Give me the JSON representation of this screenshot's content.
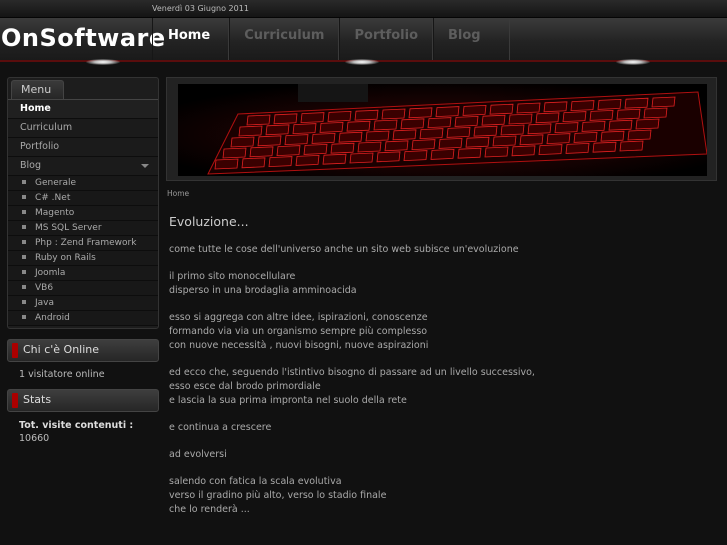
{
  "topbar": {
    "date": "Venerdì 03 Giugno 2011"
  },
  "header": {
    "logo": "OnSoftware",
    "nav": [
      {
        "label": "Home",
        "active": true
      },
      {
        "label": "Curriculum",
        "active": false
      },
      {
        "label": "Portfolio",
        "active": false
      },
      {
        "label": "Blog",
        "active": false
      }
    ]
  },
  "sidebar": {
    "menu_title": "Menu",
    "items": [
      {
        "label": "Home"
      },
      {
        "label": "Curriculum"
      },
      {
        "label": "Portfolio"
      },
      {
        "label": "Blog"
      }
    ],
    "blog_subitems": [
      "Generale",
      "C# .Net",
      "Magento",
      "MS SQL Server",
      "Php : Zend Framework",
      "Ruby on Rails",
      "Joomla",
      "VB6",
      "Java",
      "Android"
    ],
    "online": {
      "title": "Chi c'è Online",
      "text": "1 visitatore online"
    },
    "stats": {
      "title": "Stats",
      "label": "Tot. visite contenuti :",
      "value": "10660"
    }
  },
  "main": {
    "breadcrumb": "Home",
    "title": "Evoluzione...",
    "paragraphs": [
      "come tutte le cose dell'universo anche un sito web subisce un'evoluzione",
      "il primo sito monocellulare\ndisperso in una brodaglia amminoacida",
      "esso si aggrega con altre idee, ispirazioni, conoscenze\nformando via via un organismo sempre più complesso\ncon nuove necessità , nuovi bisogni, nuove aspirazioni",
      "ed ecco che, seguendo l'istintivo bisogno di passare ad un livello successivo,\nesso esce dal brodo primordiale\ne lascia la sua prima impronta nel suolo della rete",
      "e continua a crescere",
      "ad evolversi",
      "salendo con fatica la scala evolutiva\nverso il gradino più alto, verso lo stadio finale\nche lo renderà ..."
    ]
  },
  "colors": {
    "accent": "#aa0000",
    "background": "#111111"
  }
}
